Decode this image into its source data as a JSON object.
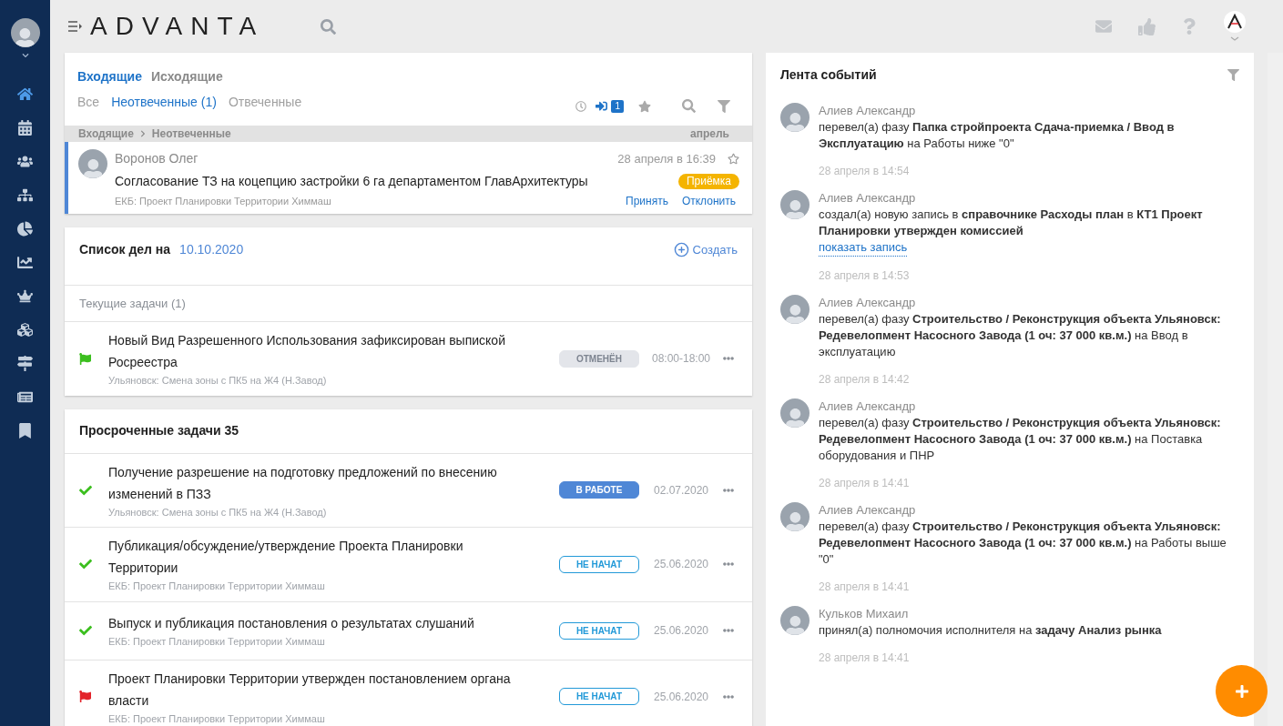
{
  "sidebar": {
    "items": [
      {
        "kind": "home",
        "selected": true
      },
      {
        "kind": "calendar",
        "selected": false
      },
      {
        "kind": "users",
        "selected": false
      },
      {
        "kind": "structure",
        "selected": false
      },
      {
        "kind": "pie",
        "selected": false
      },
      {
        "kind": "chart",
        "selected": false
      },
      {
        "kind": "crown",
        "selected": false
      },
      {
        "kind": "cubes",
        "selected": false
      },
      {
        "kind": "signs",
        "selected": false
      },
      {
        "kind": "news",
        "selected": false
      },
      {
        "kind": "bookmark",
        "selected": false
      }
    ]
  },
  "header": {
    "logo": "ADVANTA"
  },
  "inbox": {
    "tabs": [
      {
        "label": "Входящие",
        "selected": true
      },
      {
        "label": "Исходящие",
        "selected": false
      }
    ],
    "filters": [
      {
        "label": "Все",
        "selected": false
      },
      {
        "label": "Неотвеченные (1)",
        "selected": true
      },
      {
        "label": "Отвеченные",
        "selected": false
      }
    ],
    "incoming_count": "1",
    "breadcrumb": [
      "Входящие",
      "Неотвеченные"
    ],
    "month": "апрель",
    "messages": [
      {
        "sender": "Воронов Олег",
        "date": "28 апреля в 16:39",
        "subject": "Согласование ТЗ на коцепцию застройки 6 га департаментом ГлавАрхитектуры",
        "badge": "Приёмка",
        "project": "ЕКБ: Проект Планировки Территории Химмаш",
        "actions": [
          "Принять",
          "Отклонить"
        ],
        "starred": false,
        "unread": true
      }
    ]
  },
  "todo": {
    "title": "Список дел на",
    "date": "10.10.2020",
    "create": "Создать",
    "section": "Текущие задачи (1)",
    "tasks": [
      {
        "kind": "flag_green",
        "title": "Новый Вид Разрешенного Использования зафиксирован выпиской Росреестра",
        "project": "Ульяновск: Смена зоны с ПК5 на Ж4 (Н.Завод)",
        "status": {
          "text": "ОТМЕНЁН",
          "kind": "cancelled"
        },
        "time": "08:00-18:00"
      }
    ]
  },
  "overdue": {
    "title": "Просроченные задачи 35",
    "tasks": [
      {
        "kind": "check",
        "title": "Получение разрешение на подготовку предложений по внесению изменений в ПЗЗ",
        "project": "Ульяновск: Смена зоны с ПК5 на Ж4 (Н.Завод)",
        "status": {
          "text": "В РАБОТЕ",
          "kind": "in_progress"
        },
        "time": "02.07.2020"
      },
      {
        "kind": "check",
        "title": "Публикация/обсуждение/утверждение Проекта Планировки Территории",
        "project": "ЕКБ: Проект Планировки Территории Химмаш",
        "status": {
          "text": "НЕ НАЧАТ",
          "kind": "not_started"
        },
        "time": "25.06.2020"
      },
      {
        "kind": "check",
        "title": "Выпуск и публикация постановления о результатах слушаний",
        "project": "ЕКБ: Проект Планировки Территории Химмаш",
        "status": {
          "text": "НЕ НАЧАТ",
          "kind": "not_started"
        },
        "time": "25.06.2020"
      },
      {
        "kind": "flag_red",
        "title": "Проект Планировки Территории утвержден постановлением органа власти",
        "project": "ЕКБ: Проект Планировки Территории Химмаш",
        "status": {
          "text": "НЕ НАЧАТ",
          "kind": "not_started"
        },
        "time": "25.06.2020"
      }
    ]
  },
  "feed": {
    "title": "Лента событий",
    "events": [
      {
        "author": "Алиев Александр",
        "text": "перевел(а) фазу **Папка стройпроекта Сдача-приемка / Ввод в Эксплуатацию** на Работы ниже \"0\"",
        "time": "28 апреля в 14:54"
      },
      {
        "author": "Алиев Александр",
        "text": "создал(а) новую запись в **справочнике Расходы план** в **КТ1 Проект Планировки утвержден комиссией**",
        "link": "показать запись",
        "time": "28 апреля в 14:53"
      },
      {
        "author": "Алиев Александр",
        "text": "перевел(а) фазу **Строительство / Реконструкция объекта Ульяновск: Редевелопмент Насосного Завода (1 оч: 37 000 кв.м.)** на Ввод в эксплуатацию",
        "time": "28 апреля в 14:42"
      },
      {
        "author": "Алиев Александр",
        "text": "перевел(а) фазу **Строительство / Реконструкция объекта Ульяновск: Редевелопмент Насосного Завода (1 оч: 37 000 кв.м.)** на Поставка оборудования и ПНР",
        "time": "28 апреля в 14:41"
      },
      {
        "author": "Алиев Александр",
        "text": "перевел(а) фазу **Строительство / Реконструкция объекта Ульяновск: Редевелопмент Насосного Завода (1 оч: 37 000 кв.м.)** на Работы выше \"0\"",
        "time": "28 апреля в 14:41"
      },
      {
        "author": "Кульков Михаил",
        "text": "принял(а) полномочия исполнителя на **задачу Анализ рынка**",
        "time": "28 апреля в 14:41"
      }
    ]
  }
}
